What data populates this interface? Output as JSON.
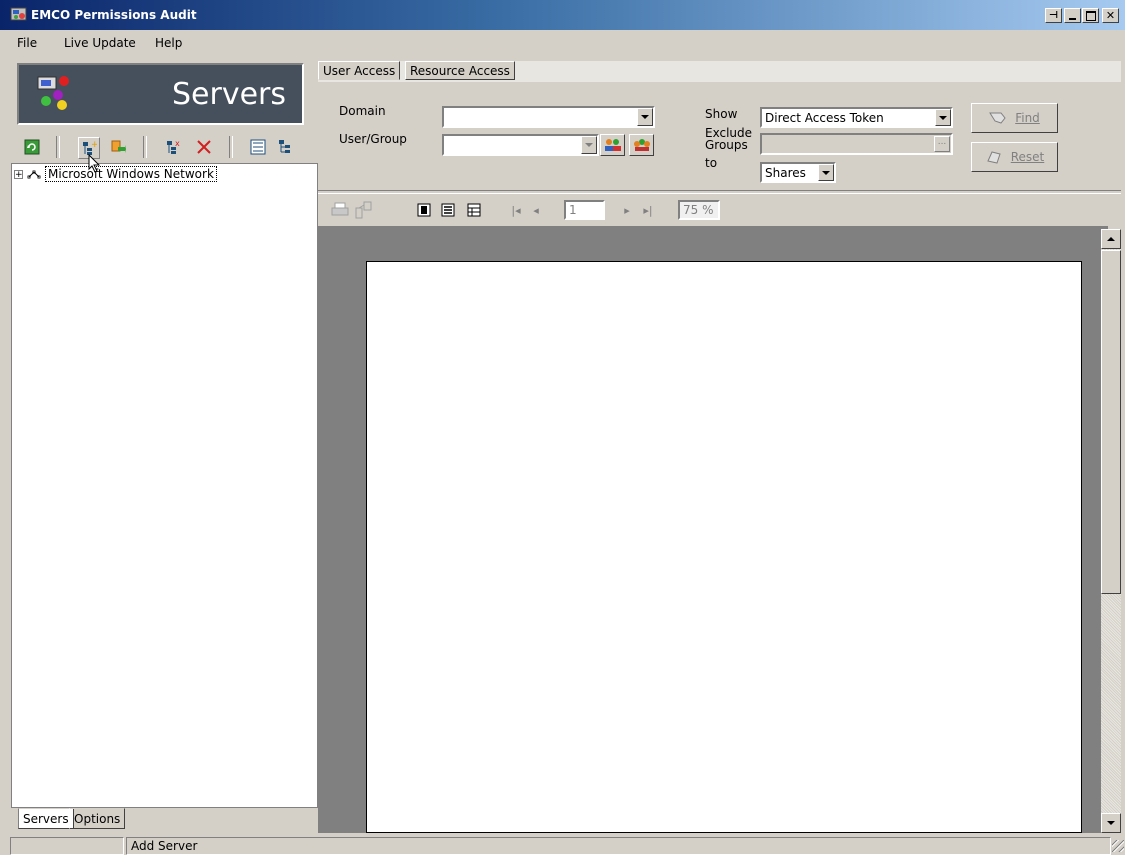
{
  "window": {
    "title": "EMCO Permissions Audit",
    "caption_buttons": [
      "pin",
      "minimize",
      "maximize",
      "close"
    ]
  },
  "menu": {
    "items": [
      {
        "label": "File"
      },
      {
        "label": "Live Update"
      },
      {
        "label": "Help"
      }
    ]
  },
  "left_panel": {
    "banner_title": "Servers",
    "toolbar_icons": [
      "refresh-icon",
      "add-server-icon",
      "import-servers-icon",
      "remove-server-icon",
      "delete-icon",
      "list-view-icon",
      "tree-view-icon"
    ],
    "tree": {
      "root_label": "Microsoft Windows Network",
      "expander": "+"
    },
    "bottom_tabs": [
      {
        "label": "Servers",
        "active": true
      },
      {
        "label": "Options",
        "active": false
      }
    ]
  },
  "right_panel": {
    "tabs": [
      {
        "label": "User Access",
        "active": true
      },
      {
        "label": "Resource Access",
        "active": false
      }
    ],
    "form": {
      "domain_label": "Domain",
      "domain_value": "",
      "user_group_label": "User/Group",
      "user_group_value": "",
      "show_label": "Show",
      "show_value": "Direct Access Token",
      "exclude_groups_label_line1": "Exclude",
      "exclude_groups_label_line2": "Groups",
      "exclude_groups_value": "",
      "to_label": "to",
      "to_value": "Shares",
      "ellipsis": "...",
      "find_label": "Find",
      "reset_label": "Reset"
    },
    "preview_toolbar": {
      "page_number": "1",
      "zoom": "75 %",
      "nav_first": "|◂",
      "nav_prev": "◂",
      "nav_next": "▸",
      "nav_last": "▸|"
    }
  },
  "status_bar": {
    "cell1": "",
    "cell2": "Add Server"
  },
  "colors": {
    "title_gradient_start": "#0a246a",
    "title_gradient_end": "#a6caf0",
    "banner_bg": "#45505c",
    "window_face": "#d4d0c8",
    "preview_bg": "#808080"
  }
}
